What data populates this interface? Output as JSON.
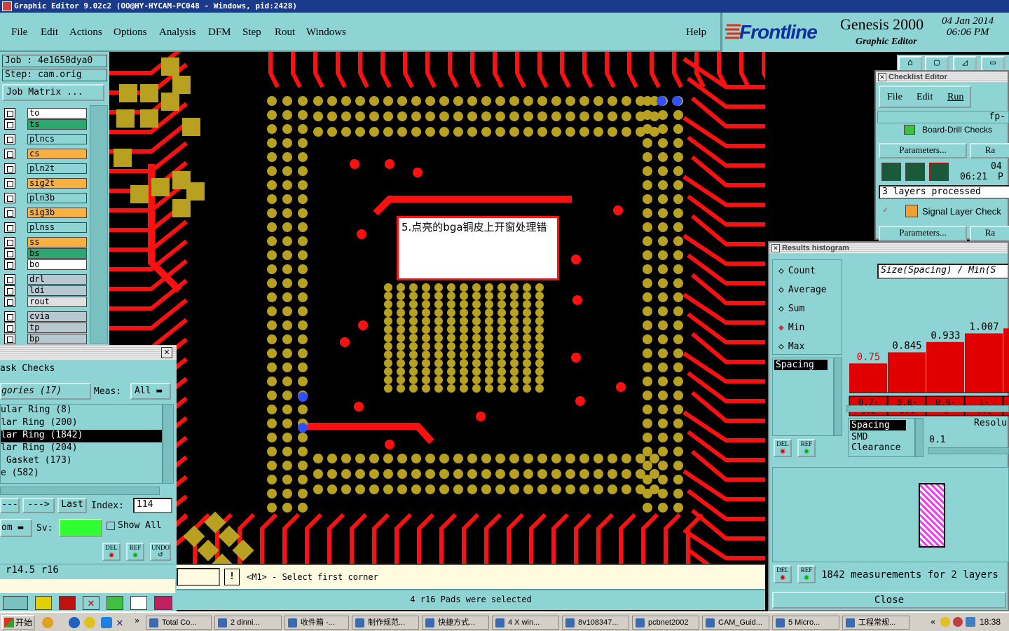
{
  "window": {
    "title": "Graphic Editor 9.02c2 (OO@HY-HYCAM-PC048 - Windows, pid:2428)"
  },
  "menu": {
    "items": [
      "File",
      "Edit",
      "Actions",
      "Options",
      "Analysis",
      "DFM",
      "Step",
      "Rout",
      "Windows"
    ],
    "help": "Help"
  },
  "brand": {
    "logo": "Frontline",
    "product": "Genesis 2000",
    "subtitle": "Graphic Editor",
    "date": "04 Jan 2014",
    "time": "06:06 PM"
  },
  "job": {
    "job_label": "Job : 4e1650dya0",
    "step_label": "Step: cam.orig",
    "matrix_button": "Job Matrix ..."
  },
  "layers": [
    {
      "name": "to",
      "color": "#ffffff"
    },
    {
      "name": "ts",
      "color": "#2aa870"
    },
    {
      "name": "plncs",
      "color": "#8fd4d4"
    },
    {
      "name": "cs",
      "color": "#f8b040"
    },
    {
      "name": "pln2t",
      "color": "#8fd4d4"
    },
    {
      "name": "sig2t",
      "color": "#f8b040"
    },
    {
      "name": "pln3b",
      "color": "#8fd4d4"
    },
    {
      "name": "sig3b",
      "color": "#f8b040"
    },
    {
      "name": "plnss",
      "color": "#8fd4d4"
    },
    {
      "name": "ss",
      "color": "#f8b040"
    },
    {
      "name": "bs",
      "color": "#2aa870"
    },
    {
      "name": "bo",
      "color": "#ffffff"
    },
    {
      "name": "drl",
      "color": "#b8c8d0"
    },
    {
      "name": "ldi",
      "color": "#b8c8d0"
    },
    {
      "name": "rout",
      "color": "#e0e0e0"
    },
    {
      "name": "cvia",
      "color": "#b8c8d0"
    },
    {
      "name": "tp",
      "color": "#b8c8d0"
    },
    {
      "name": "bp",
      "color": "#b8c8d0"
    }
  ],
  "mask_checks": {
    "title": "ask Checks",
    "categories_label": "gories (17)",
    "meas_label": "Meas:",
    "meas_value": "All",
    "items": [
      "ular Ring (8)",
      "lar Ring (200)",
      "lar Ring (1842)",
      "lar Ring (204)",
      " Gasket (173)",
      "e (582)"
    ],
    "selected_index": 2,
    "prev_button": "---",
    "next_button": "--->",
    "last_button": "Last",
    "index_label": "Index:",
    "index_value": "114",
    "sort_value": "om",
    "sv_label": "Sv:",
    "show_all_label": "Show All",
    "del_label": "DEL",
    "ref_label": "REF",
    "undo_label": "UNDO",
    "sizes": "r14.5  r16"
  },
  "annotation": {
    "text": "5.点亮的bga铜皮上开窗处理错"
  },
  "command": {
    "prompt": "<M1> - Select first corner",
    "status": "4 r16 Pads were selected"
  },
  "checklist": {
    "title": "Checklist Editor",
    "menu": [
      "File",
      "Edit",
      "Run"
    ],
    "fp_label": "fp-",
    "board_drill": "Board-Drill Checks",
    "params1": "Parameters...",
    "ra1": "Ra",
    "date": "04",
    "time": "06:21",
    "time_suffix": "P",
    "processed": "3 layers processed",
    "signal": "Signal Layer Check",
    "params2": "Parameters...",
    "ra2": "Ra"
  },
  "histogram": {
    "title": "Results histogram",
    "modes": [
      "Count",
      "Average",
      "Sum",
      "Min",
      "Max"
    ],
    "selected_mode": "Min",
    "header": "Size(Spacing) / Min(S",
    "type_list_selected": "Spacing",
    "del_label": "DEL",
    "ref_label": "REF",
    "category_list": [
      "Spacing",
      "SMD",
      "Clearance"
    ],
    "resolution_label": "Resolu",
    "resolution_value": "0.1",
    "summary": "1842 measurements for 2 layers",
    "close_button": "Close"
  },
  "chart_data": {
    "type": "bar",
    "categories": [
      "0.7-0.8",
      "0.8-0.9",
      "0.9-1",
      "1-1.1",
      ""
    ],
    "values": [
      0.75,
      0.845,
      0.933,
      1.007,
      1.05
    ],
    "value_labels": [
      "0.75",
      "0.845",
      "0.933",
      "1.007",
      ""
    ],
    "bin_labels": [
      [
        "0.7-",
        "0.8"
      ],
      [
        "0.8-",
        "0.9"
      ],
      [
        "0.9-",
        "1"
      ],
      [
        "1-",
        "1.1"
      ],
      [
        "",
        ""
      ]
    ],
    "ylim": [
      0.5,
      1.1
    ],
    "colors": {
      "bar": "#e00000",
      "label_first": "#e00000",
      "label_rest": "#000000"
    }
  },
  "taskbar": {
    "start": "开始",
    "tasks": [
      "Total Co...",
      "2 dinni...",
      "收件箱 -...",
      "制作规范...",
      "快捷方式...",
      "4 X win...",
      "8v108347...",
      "pcbnet2002",
      "CAM_Guid...",
      "5 Micro...",
      "工程常规..."
    ],
    "clock": "18:38"
  },
  "colors": {
    "panel": "#8fd4d4",
    "copper": "#ff1010",
    "pad": "#b8a020",
    "title_bar": "#1a3a8c"
  }
}
